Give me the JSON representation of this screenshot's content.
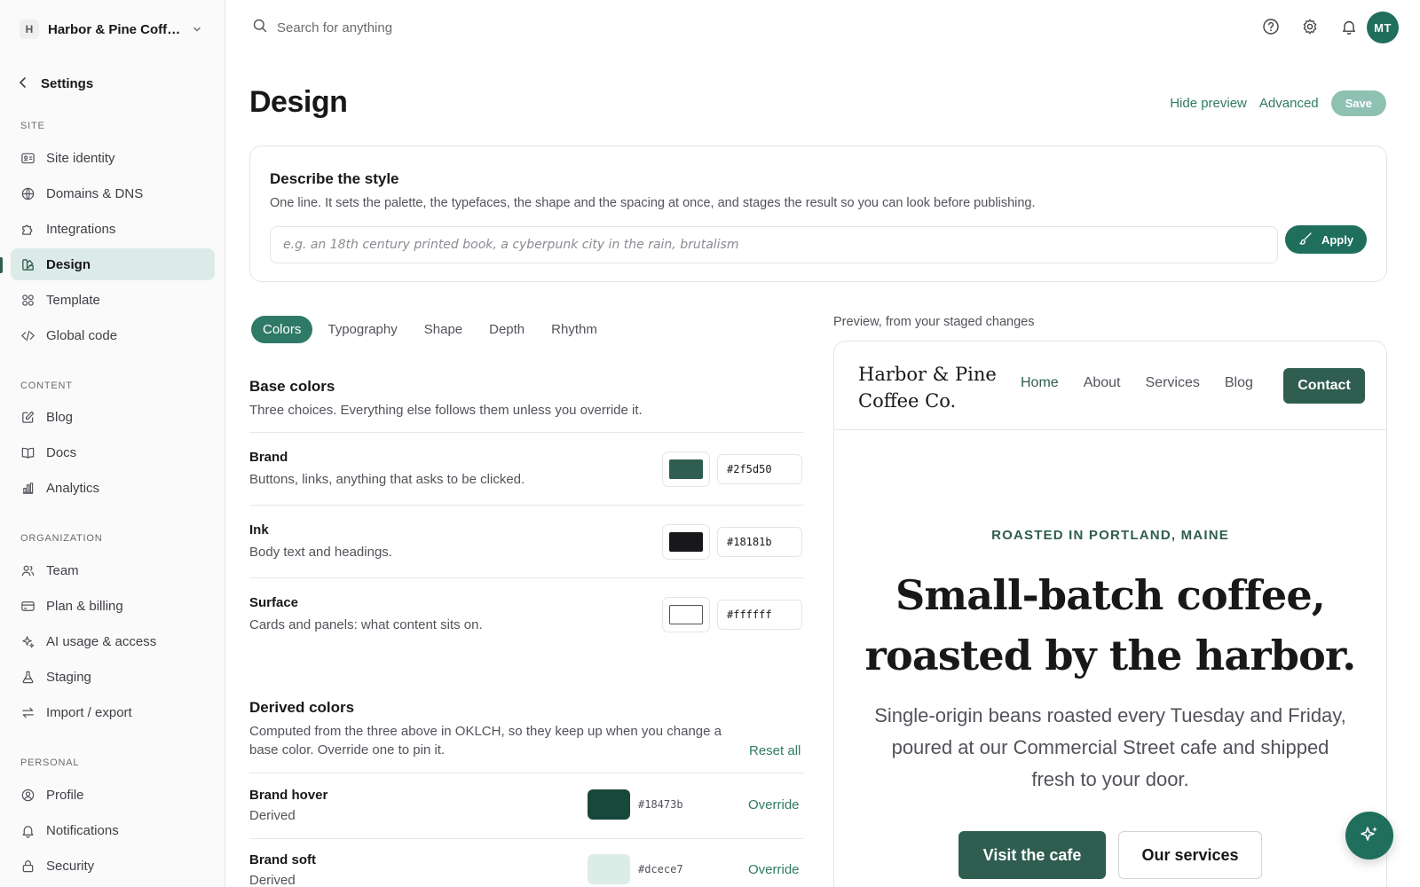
{
  "workspace": {
    "initial": "H",
    "name": "Harbor & Pine Coffee Co."
  },
  "sidebar": {
    "back_label": "Settings",
    "sections": {
      "site": "SITE",
      "content": "CONTENT",
      "organization": "ORGANIZATION",
      "personal": "PERSONAL"
    },
    "items": {
      "site_identity": "Site identity",
      "domains": "Domains & DNS",
      "integrations": "Integrations",
      "design": "Design",
      "template": "Template",
      "global_code": "Global code",
      "blog": "Blog",
      "docs": "Docs",
      "analytics": "Analytics",
      "team": "Team",
      "billing": "Plan & billing",
      "ai_usage": "AI usage & access",
      "staging": "Staging",
      "import_export": "Import / export",
      "profile": "Profile",
      "notifications": "Notifications",
      "security": "Security"
    }
  },
  "topbar": {
    "search_placeholder": "Search for anything",
    "avatar_initials": "MT"
  },
  "header": {
    "title": "Design",
    "hide_preview": "Hide preview",
    "advanced": "Advanced",
    "save": "Save"
  },
  "style_card": {
    "title": "Describe the style",
    "description": "One line. It sets the palette, the typefaces, the shape and the spacing at once, and stages the result so you can look before publishing.",
    "placeholder": "e.g. an 18th century printed book, a cyberpunk city in the rain, brutalism",
    "apply": "Apply"
  },
  "tabs": [
    "Colors",
    "Typography",
    "Shape",
    "Depth",
    "Rhythm"
  ],
  "base_colors": {
    "title": "Base colors",
    "description": "Three choices. Everything else follows them unless you override it.",
    "rows": [
      {
        "name": "Brand",
        "sub": "Buttons, links, anything that asks to be clicked.",
        "hex": "#2f5d50"
      },
      {
        "name": "Ink",
        "sub": "Body text and headings.",
        "hex": "#18181b"
      },
      {
        "name": "Surface",
        "sub": "Cards and panels: what content sits on.",
        "hex": "#ffffff"
      }
    ]
  },
  "derived_colors": {
    "title": "Derived colors",
    "description": "Computed from the three above in OKLCH, so they keep up when you change a base color. Override one to pin it.",
    "reset": "Reset all",
    "rows": [
      {
        "name": "Brand hover",
        "sub": "Derived",
        "hex": "#18473b",
        "action": "Override"
      },
      {
        "name": "Brand soft",
        "sub": "Derived",
        "hex": "#dcece7",
        "action": "Override"
      }
    ]
  },
  "preview": {
    "label": "Preview, from your staged changes",
    "logo": "Harbor & Pine Coffee Co.",
    "nav": [
      "Home",
      "About",
      "Services",
      "Blog"
    ],
    "contact": "Contact",
    "eyebrow": "ROASTED IN PORTLAND, MAINE",
    "headline": "Small-batch coffee, roasted by the harbor.",
    "body": "Single-origin beans roasted every Tuesday and Friday, poured at our Commercial Street cafe and shipped fresh to your door.",
    "primary_cta": "Visit the cafe",
    "secondary_cta": "Our services"
  },
  "icons": {
    "search": "search-icon",
    "help": "help-icon",
    "settings": "gear-icon",
    "bell": "bell-icon",
    "back": "chevron-left-icon",
    "fab": "sparkle-icon",
    "apply": "brush-icon"
  },
  "colors": {
    "accent": "#1f6f5c",
    "brand": "#2f5d50",
    "active_bg": "#dcebe7"
  }
}
